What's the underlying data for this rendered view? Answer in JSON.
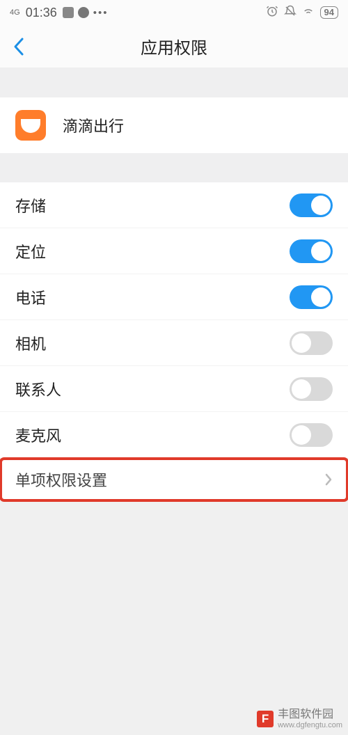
{
  "status": {
    "network": "4G",
    "time": "01:36",
    "battery": "94"
  },
  "nav": {
    "title": "应用权限"
  },
  "app": {
    "name": "滴滴出行",
    "icon_name": "didi-logo-icon"
  },
  "permissions": [
    {
      "label": "存储",
      "enabled": true
    },
    {
      "label": "定位",
      "enabled": true
    },
    {
      "label": "电话",
      "enabled": true
    },
    {
      "label": "相机",
      "enabled": false
    },
    {
      "label": "联系人",
      "enabled": false
    },
    {
      "label": "麦克风",
      "enabled": false
    }
  ],
  "single_perm": {
    "label": "单项权限设置"
  },
  "watermark": {
    "brand": "丰图软件园",
    "url": "www.dgfengtu.com",
    "badge": "F"
  }
}
